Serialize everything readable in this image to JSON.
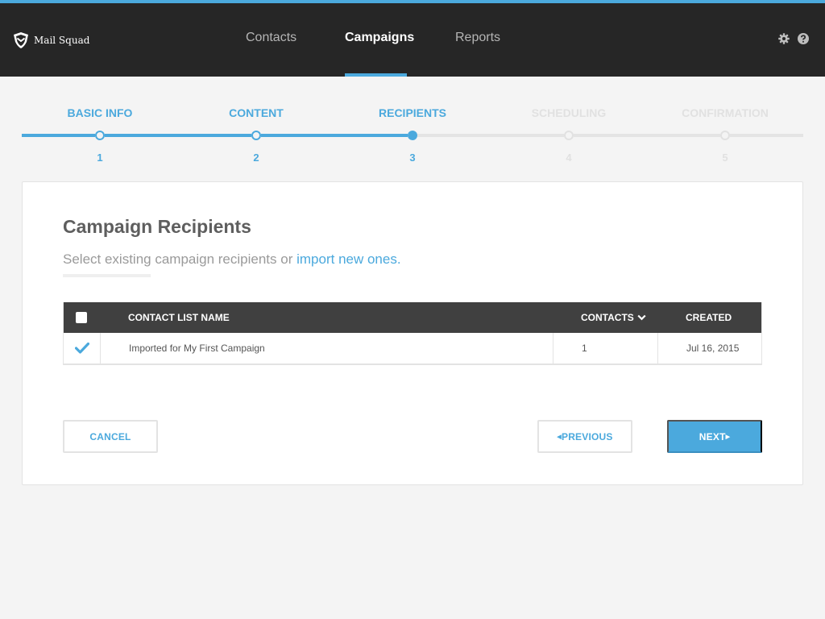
{
  "app": {
    "name": "Mail Squad",
    "accent_color": "#4ba9dd",
    "header_color": "#262626"
  },
  "nav": {
    "items": [
      {
        "label": "Contacts",
        "active": false
      },
      {
        "label": "Campaigns",
        "active": true
      },
      {
        "label": "Reports",
        "active": false
      }
    ],
    "icons": [
      "gear-icon",
      "help-icon"
    ]
  },
  "stepper": {
    "steps": [
      {
        "label": "BASIC INFO",
        "number": "1",
        "state": "complete"
      },
      {
        "label": "CONTENT",
        "number": "2",
        "state": "complete"
      },
      {
        "label": "RECIPIENTS",
        "number": "3",
        "state": "current"
      },
      {
        "label": "SCHEDULING",
        "number": "4",
        "state": "upcoming"
      },
      {
        "label": "CONFIRMATION",
        "number": "5",
        "state": "upcoming"
      }
    ]
  },
  "main": {
    "title": "Campaign Recipients",
    "subtitle_prefix": "Select existing campaign recipients or",
    "subtitle_link": "import new ones."
  },
  "table": {
    "headers": {
      "name": "CONTACT LIST NAME",
      "contacts": "CONTACTS",
      "created": "CREATED"
    },
    "select_all_checked": false,
    "rows": [
      {
        "checked": true,
        "name": "Imported for My First Campaign",
        "contacts": "1",
        "created": "Jul 16, 2015"
      }
    ]
  },
  "actions": {
    "cancel": "CANCEL",
    "previous": "PREVIOUS",
    "next": "NEXT"
  }
}
